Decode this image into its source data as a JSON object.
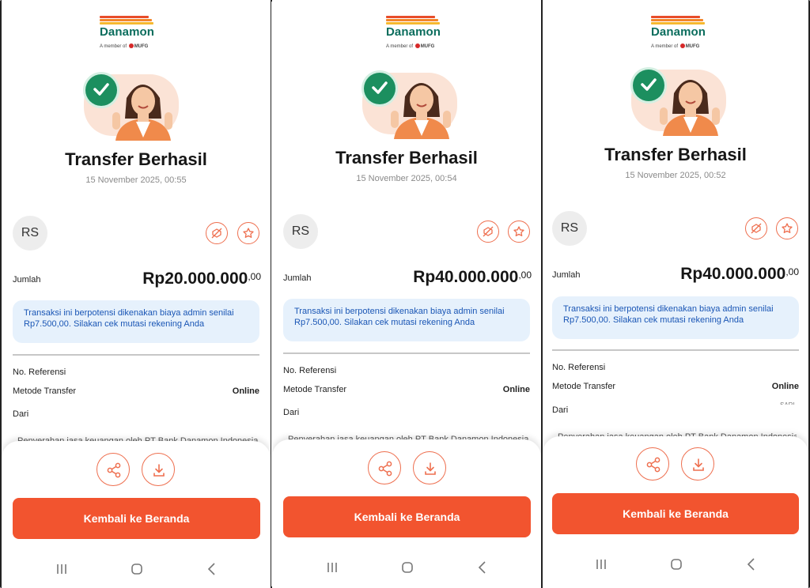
{
  "bank": {
    "name": "Danamon",
    "tagline_prefix": "A member of",
    "tagline_group": "MUFG",
    "bar_colors": [
      "#e84d2a",
      "#f3862b",
      "#f7b82e"
    ]
  },
  "colors": {
    "accent": "#f2542f",
    "brand_green": "#0b6d5d",
    "success": "#1c8f5f",
    "notice_bg": "#e6f1fc",
    "notice_text": "#1a56b5"
  },
  "screens": [
    {
      "title": "Transfer Berhasil",
      "datetime": "15 November 2025, 00:55",
      "initials": "RS",
      "amount_label": "Jumlah",
      "amount_main": "Rp20.000.000",
      "amount_decimal": ",00",
      "notice": "Transaksi ini berpotensi dikenakan biaya admin senilai Rp7.500,00. Silakan cek mutasi rekening Anda",
      "ref_label": "No. Referensi",
      "method_label": "Metode Transfer",
      "method_value": "Online",
      "from_label": "Dari",
      "footnote": "Penyerahan jasa keuangan oleh PT Bank Danamon Indonesia",
      "cta": "Kembali ke Beranda"
    },
    {
      "title": "Transfer Berhasil",
      "datetime": "15 November 2025, 00:54",
      "initials": "RS",
      "amount_label": "Jumlah",
      "amount_main": "Rp40.000.000",
      "amount_decimal": ",00",
      "notice": "Transaksi ini berpotensi dikenakan biaya admin senilai Rp7.500,00. Silakan cek mutasi rekening Anda",
      "ref_label": "No. Referensi",
      "method_label": "Metode Transfer",
      "method_value": "Online",
      "from_label": "Dari",
      "footnote": "Penyerahan jasa keuangan oleh PT Bank Danamon Indonesia",
      "cta": "Kembali ke Beranda"
    },
    {
      "title": "Transfer Berhasil",
      "datetime": "15 November 2025, 00:52",
      "initials": "RS",
      "amount_label": "Jumlah",
      "amount_main": "Rp40.000.000",
      "amount_decimal": ",00",
      "notice": "Transaksi ini berpotensi dikenakan biaya admin senilai Rp7.500,00. Silakan cek mutasi rekening Anda",
      "ref_label": "No. Referensi",
      "method_label": "Metode Transfer",
      "method_value": "Online",
      "from_label": "Dari",
      "from_value_fragment": "SARI",
      "footnote": "Penyerahan jasa keuangan oleh PT Bank Danamon Indonesia",
      "cta": "Kembali ke Beranda"
    }
  ],
  "icons": {
    "avatar_actions": [
      "hide-icon",
      "star-icon"
    ],
    "sheet_actions": [
      "share-icon",
      "download-icon"
    ],
    "nav": [
      "recents-icon",
      "home-icon",
      "back-icon"
    ]
  }
}
